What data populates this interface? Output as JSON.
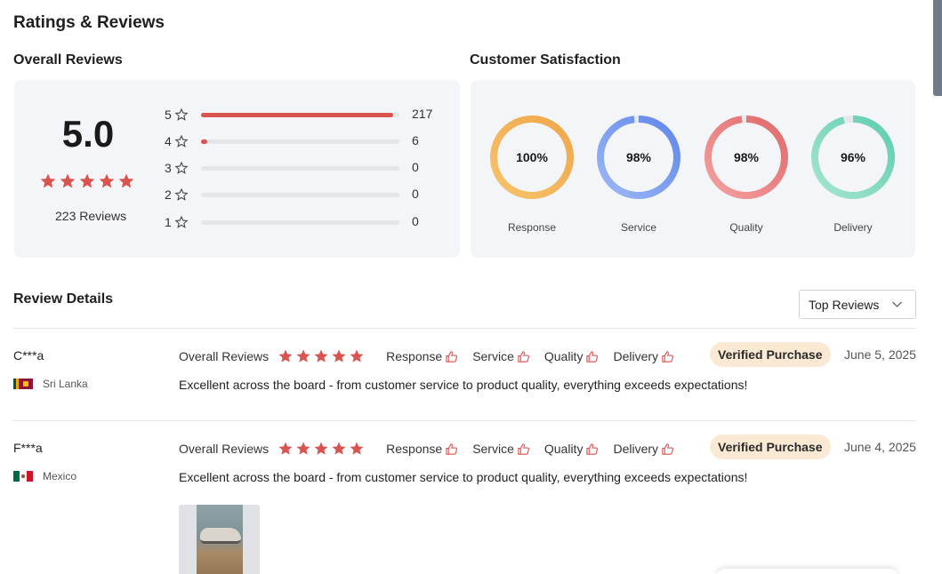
{
  "page_title": "Ratings & Reviews",
  "overall": {
    "section_title": "Overall Reviews",
    "score": "5.0",
    "stars_filled": 5,
    "review_count": "223 Reviews",
    "distribution": [
      {
        "stars": "5",
        "count": "217",
        "fraction": 0.97
      },
      {
        "stars": "4",
        "count": "6",
        "fraction": 0.03
      },
      {
        "stars": "3",
        "count": "0",
        "fraction": 0
      },
      {
        "stars": "2",
        "count": "0",
        "fraction": 0
      },
      {
        "stars": "1",
        "count": "0",
        "fraction": 0
      }
    ]
  },
  "satisfaction": {
    "section_title": "Customer Satisfaction",
    "metrics": [
      {
        "label": "Response",
        "value": "100%",
        "percent": 100,
        "color_start": "#f6c36b",
        "color_end": "#f0a64a"
      },
      {
        "label": "Service",
        "value": "98%",
        "percent": 98,
        "color_start": "#9db8f5",
        "color_end": "#5f86ea"
      },
      {
        "label": "Quality",
        "value": "98%",
        "percent": 98,
        "color_start": "#f4a0a0",
        "color_end": "#e06a6a"
      },
      {
        "label": "Delivery",
        "value": "96%",
        "percent": 96,
        "color_start": "#a6e6cf",
        "color_end": "#5fcdb0"
      }
    ]
  },
  "details": {
    "section_title": "Review Details",
    "sort": {
      "selected": "Top Reviews",
      "icon": "chevron-down-icon"
    },
    "overall_label": "Overall Reviews",
    "aspects": [
      "Response",
      "Service",
      "Quality",
      "Delivery"
    ],
    "badge": "Verified Purchase",
    "reviews": [
      {
        "name": "C***a",
        "country": "Sri Lanka",
        "date": "June 5, 2025",
        "text": "Excellent across the board - from customer service to product quality, everything exceeds expectations!"
      },
      {
        "name": "F***a",
        "country": "Mexico",
        "date": "June 4, 2025",
        "text": "Excellent across the board - from customer service to product quality, everything exceeds expectations!"
      }
    ]
  },
  "colors": {
    "star": "#d9534f",
    "bar_fill": "#d9534f",
    "badge_bg": "#fbe9d4"
  }
}
